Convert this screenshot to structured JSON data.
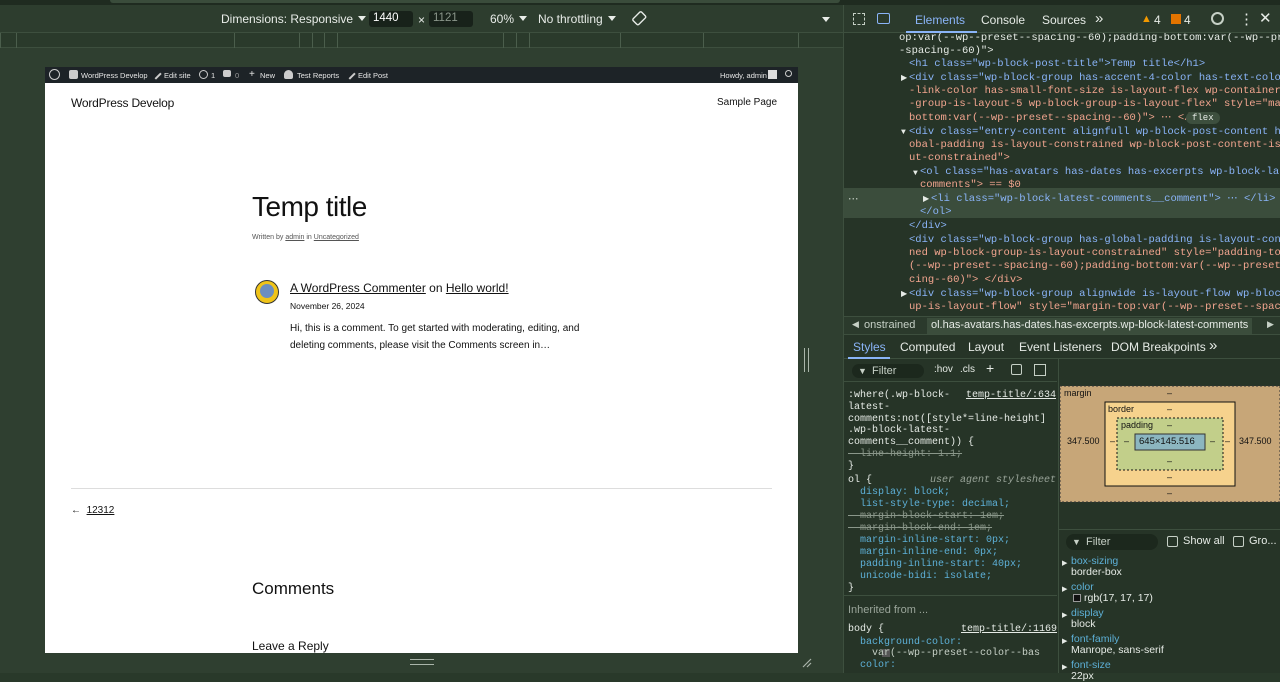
{
  "toolbar": {
    "dimensions": "Dimensions: Responsive",
    "width": "1440",
    "x": "×",
    "height": "1121",
    "zoom": "60%",
    "throttling": "No throttling"
  },
  "wp": {
    "adminbar": {
      "site": "WordPress Develop",
      "edit_site": "Edit site",
      "updates": "1",
      "comments": "0",
      "new": "New",
      "test_reports": "Test Reports",
      "edit_post": "Edit Post",
      "howdy": "Howdy, admin"
    },
    "site_title": "WordPress Develop",
    "nav_link": "Sample Page",
    "post_title": "Temp title",
    "byline_prefix": "Written by",
    "byline_author": "admin",
    "byline_in": "in",
    "byline_category": "Uncategorized",
    "comment": {
      "author": "A WordPress Commenter",
      "on": "on",
      "post": "Hello world!",
      "date": "November 26, 2024",
      "excerpt": "Hi, this is a comment. To get started with moderating, editing, and deleting comments, please visit the Comments screen in…"
    },
    "prev_arrow": "←",
    "prev_link": "12312",
    "comments_heading": "Comments",
    "reply_heading": "Leave a Reply"
  },
  "devtools": {
    "tabs": [
      "Elements",
      "Console",
      "Sources"
    ],
    "more": "»",
    "warnings": "4",
    "issues": "4",
    "dom_lines": [
      "op:var(--wp--preset--spacing--60);padding-bottom:var(--wp--preset-",
      "-spacing--60)\">",
      "<h1 class=\"wp-block-post-title\">Temp title</h1>",
      "<div class=\"wp-block-group has-accent-4-color has-text-color has",
      "-link-color has-small-font-size is-layout-flex wp-container-core",
      "-group-is-layout-5 wp-block-group-is-layout-flex\" style=\"margin-",
      "bottom:var(--wp--preset--spacing--60)\"> ⋯ </div>",
      "<div class=\"entry-content alignfull wp-block-post-content has-gl",
      "obal-padding is-layout-constrained wp-block-post-content-is-layo",
      "ut-constrained\">",
      "<ol class=\"has-avatars has-dates has-excerpts wp-block-latest-",
      "comments\"> == $0",
      "<li class=\"wp-block-latest-comments__comment\"> ⋯ </li>",
      "</ol>",
      "</div>",
      "<div class=\"wp-block-group has-global-padding is-layout-constrai",
      "ned wp-block-group-is-layout-constrained\" style=\"padding-top:var",
      "(--wp--preset--spacing--60);padding-bottom:var(--wp--preset--spa",
      "cing--60)\"> </div>",
      "<div class=\"wp-block-group alignwide is-layout-flow wp-block-gro",
      "up-is-layout-flow\" style=\"margin-top:var(--wp--preset--spacing--"
    ],
    "flex_badge": "flex",
    "crumbs": [
      "onstrained",
      "ol.has-avatars.has-dates.has-excerpts.wp-block-latest-comments"
    ],
    "subtabs": [
      "Styles",
      "Computed",
      "Layout",
      "Event Listeners",
      "DOM Breakpoints"
    ],
    "filter": "Filter",
    "hov": ":hov",
    "cls": ".cls",
    "styles_lines": [
      ":where(.wp-block-",
      "latest-",
      "comments:not([style*=line-height]",
      ".wp-block-latest-",
      "comments__comment)) {",
      "  line-height: 1.1;",
      "}",
      "ol {",
      "  display: block;",
      "  list-style-type: decimal;",
      "  margin-block-start: 1em;",
      "  margin-block-end: 1em;",
      "  margin-inline-start: 0px;",
      "  margin-inline-end: 0px;",
      "  padding-inline-start: 40px;",
      "  unicode-bidi: isolate;",
      "}",
      "Inherited from ...",
      "body {",
      "  background-color:",
      "    var(--wp--preset--color--bas",
      "  color:"
    ],
    "rule_src_1": "temp-title/:634",
    "rule_src_2": "user agent stylesheet",
    "rule_src_3": "temp-title/:1169",
    "boxmodel": {
      "margin_label": "margin",
      "border_label": "border",
      "padding_label": "padding",
      "content": "645×145.516",
      "margin_left": "347.500",
      "margin_right": "347.500",
      "dash": "–"
    },
    "computed_filter": "Filter",
    "show_all": "Show all",
    "group": "Gro...",
    "computed": [
      {
        "k": "box-sizing",
        "v": "border-box"
      },
      {
        "k": "color",
        "v": "rgb(17, 17, 17)"
      },
      {
        "k": "display",
        "v": "block"
      },
      {
        "k": "font-family",
        "v": "Manrope, sans-serif"
      },
      {
        "k": "font-size",
        "v": "22px"
      }
    ]
  },
  "colors": {
    "devtools_bg": "#263427",
    "selected_row": "#3b4d3c",
    "wp_adminbar": "#1d2327",
    "warning": "#f29900",
    "issue": "#e37400"
  }
}
